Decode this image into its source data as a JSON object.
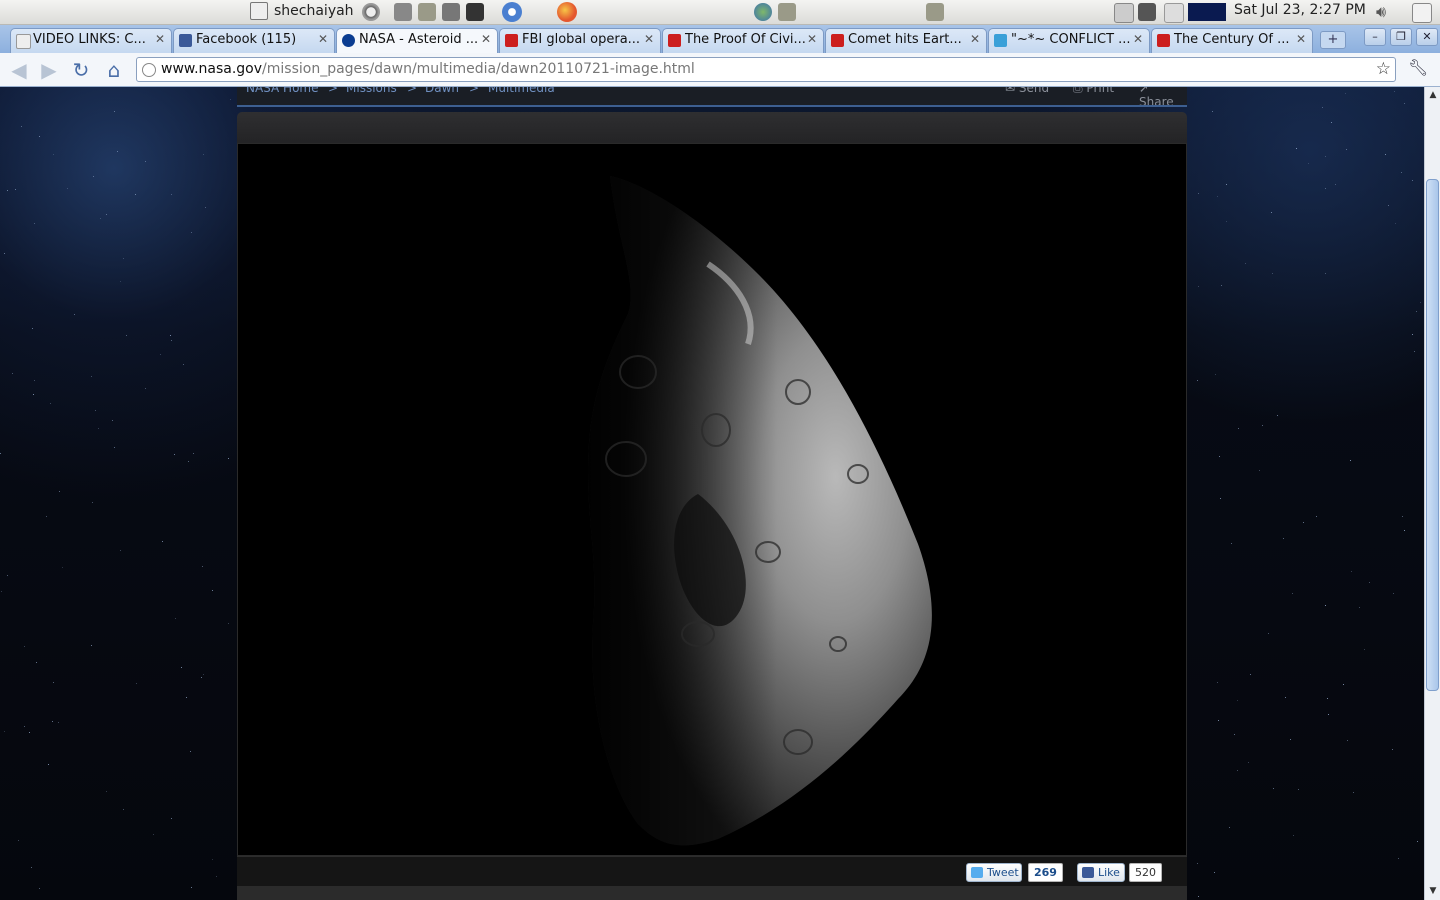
{
  "panel": {
    "user": "shechaiyah",
    "clock": "Sat Jul 23,  2:27 PM",
    "icons": [
      "power-icon",
      "network-icon",
      "folder-icon",
      "settings-icon",
      "terminal-icon",
      "chromium-icon",
      "firefox-icon",
      "globe-icon",
      "folder-icon",
      "folder-icon",
      "printer-icon",
      "monitor-icon",
      "edit-icon",
      "system-monitor-icon",
      "volume-icon",
      "mail-icon"
    ]
  },
  "tabs": [
    {
      "title": "VIDEO LINKS: C...",
      "icon": "page-icon"
    },
    {
      "title": "Facebook (115)",
      "icon": "facebook-icon"
    },
    {
      "title": "NASA - Asteroid ...",
      "icon": "nasa-icon",
      "active": true
    },
    {
      "title": "FBI global opera...",
      "icon": "youtube-icon"
    },
    {
      "title": "The Proof Of Civi...",
      "icon": "youtube-icon"
    },
    {
      "title": "Comet hits Eart...",
      "icon": "youtube-icon"
    },
    {
      "title": "\"~*~ CONFLICT ...",
      "icon": "skype-icon"
    },
    {
      "title": "The Century Of ...",
      "icon": "youtube-icon"
    }
  ],
  "toolbar": {
    "url_host": "www.nasa.gov",
    "url_path": "/mission_pages/dawn/multimedia/dawn20110721-image.html"
  },
  "breadcrumb": {
    "items": [
      "NASA Home",
      "Missions",
      "Dawn",
      "Multimedia"
    ],
    "separator": ">"
  },
  "page_actions": {
    "send": "Send",
    "print": "Print",
    "share": "Share"
  },
  "share": {
    "tweet_label": "Tweet",
    "tweet_count": "269",
    "like_label": "Like",
    "like_count": "520"
  },
  "colors": {
    "accent": "#3d5f91",
    "link": "#6f8fc0",
    "tab_bg": "#c5d8f0"
  }
}
